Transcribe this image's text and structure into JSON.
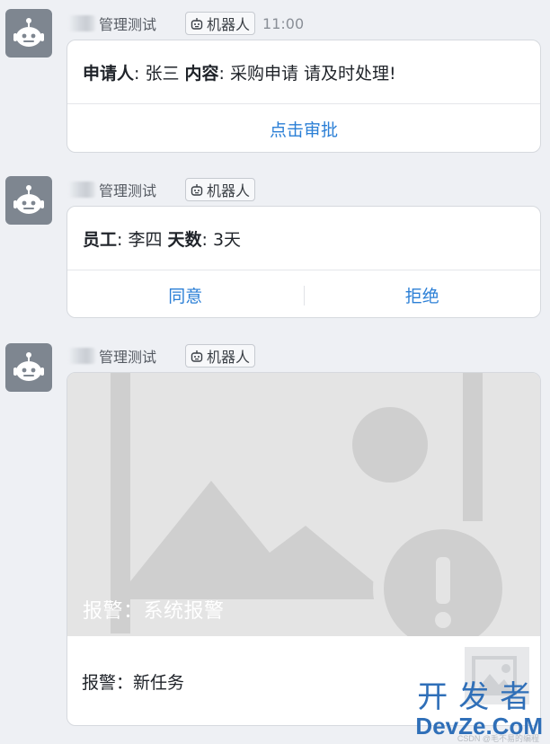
{
  "messages": [
    {
      "sender": "管理测试",
      "bot_tag": "机器人",
      "time": "11:00",
      "body": [
        {
          "bold": "申请人",
          "text": ": 张三 "
        },
        {
          "bold": "内容",
          "text": ": 采购申请 请及时处理!"
        }
      ],
      "actions": [
        "点击审批"
      ]
    },
    {
      "sender": "管理测试",
      "bot_tag": "机器人",
      "time": "",
      "body": [
        {
          "bold": "员工",
          "text": ": 李四 "
        },
        {
          "bold": "天数",
          "text": ": 3天"
        }
      ],
      "actions": [
        "同意",
        "拒绝"
      ]
    },
    {
      "sender": "管理测试",
      "bot_tag": "机器人",
      "time": "",
      "image_caption": "报警：系统报警",
      "footer_text": "报警：新任务"
    }
  ],
  "watermark": {
    "top": "开发者",
    "bottom": "DevZe.CoM",
    "tiny": "CSDN @毛不易的编程"
  },
  "icons": {
    "avatar": "robot-avatar-icon",
    "tag": "robot-icon",
    "image_placeholder": "image-placeholder-icon",
    "warning": "exclamation-icon"
  },
  "colors": {
    "action_blue": "#2b7fd6",
    "avatar_bg": "#7e8690",
    "page_bg": "#eef0f4",
    "watermark_blue": "#2f6fb8"
  }
}
